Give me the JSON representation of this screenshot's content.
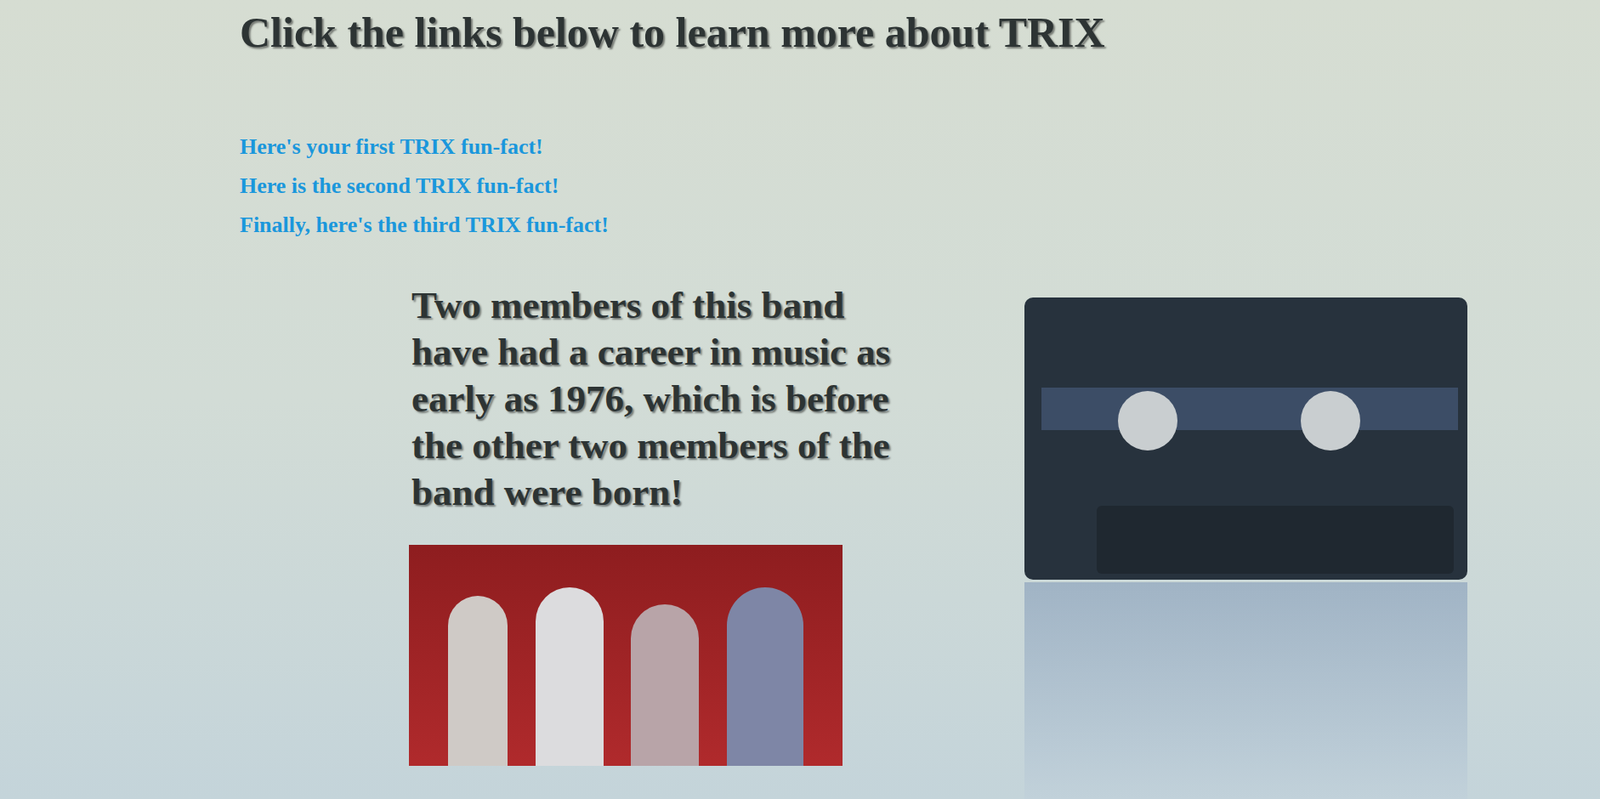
{
  "heading": "Click the links below to learn more about TRIX",
  "links": [
    "Here's your first TRIX fun-fact!",
    "Here is the second TRIX fun-fact!",
    "Finally, here's the third TRIX fun-fact!"
  ],
  "fact": "Two members of this band have had a career in music as early as 1976, which is before the other two members of the band were born!"
}
